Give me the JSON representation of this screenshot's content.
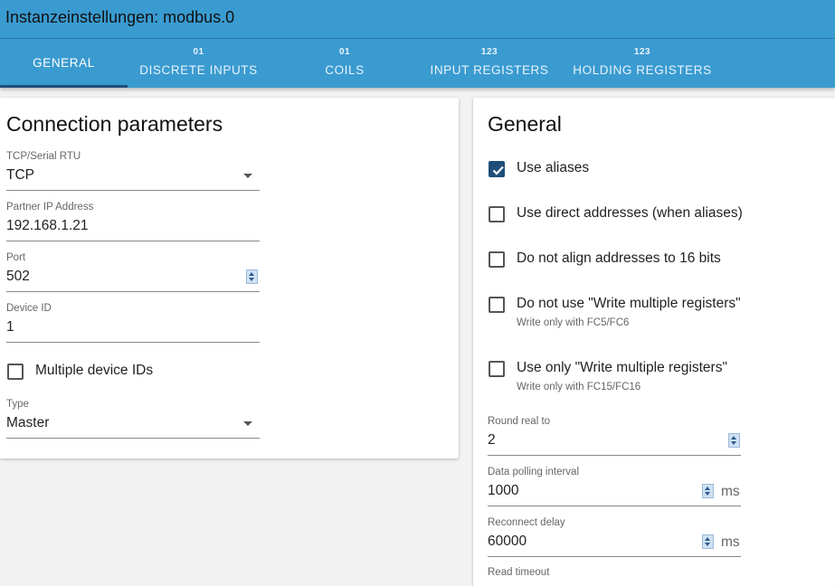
{
  "window": {
    "title": "Instanzeinstellungen: modbus.0"
  },
  "tabs": [
    {
      "icon": "",
      "label": "GENERAL",
      "active": true
    },
    {
      "icon": "01",
      "label": "DISCRETE INPUTS"
    },
    {
      "icon": "01",
      "label": "COILS"
    },
    {
      "icon": "123",
      "label": "INPUT REGISTERS"
    },
    {
      "icon": "123",
      "label": "HOLDING REGISTERS"
    }
  ],
  "connection": {
    "heading": "Connection parameters",
    "tcp_serial": {
      "label": "TCP/Serial RTU",
      "value": "TCP"
    },
    "partner_ip": {
      "label": "Partner IP Address",
      "value": "192.168.1.21"
    },
    "port": {
      "label": "Port",
      "value": "502"
    },
    "device_id": {
      "label": "Device ID",
      "value": "1"
    },
    "multiple_ids": {
      "label": "Multiple device IDs",
      "checked": false
    },
    "type": {
      "label": "Type",
      "value": "Master"
    }
  },
  "general": {
    "heading": "General",
    "use_aliases": {
      "label": "Use aliases",
      "checked": true
    },
    "use_direct": {
      "label": "Use direct addresses (when aliases)",
      "checked": false
    },
    "no_align": {
      "label": "Do not align addresses to 16 bits",
      "checked": false
    },
    "no_write_multiple": {
      "label": "Do not use \"Write multiple registers\"",
      "help": "Write only with FC5/FC6",
      "checked": false
    },
    "only_write_multiple": {
      "label": "Use only \"Write multiple registers\"",
      "help": "Write only with FC15/FC16",
      "checked": false
    },
    "round_real": {
      "label": "Round real to",
      "value": "2"
    },
    "poll_interval": {
      "label": "Data polling interval",
      "value": "1000",
      "unit": "ms"
    },
    "reconnect_delay": {
      "label": "Reconnect delay",
      "value": "60000",
      "unit": "ms"
    },
    "read_timeout": {
      "label": "Read timeout"
    }
  }
}
